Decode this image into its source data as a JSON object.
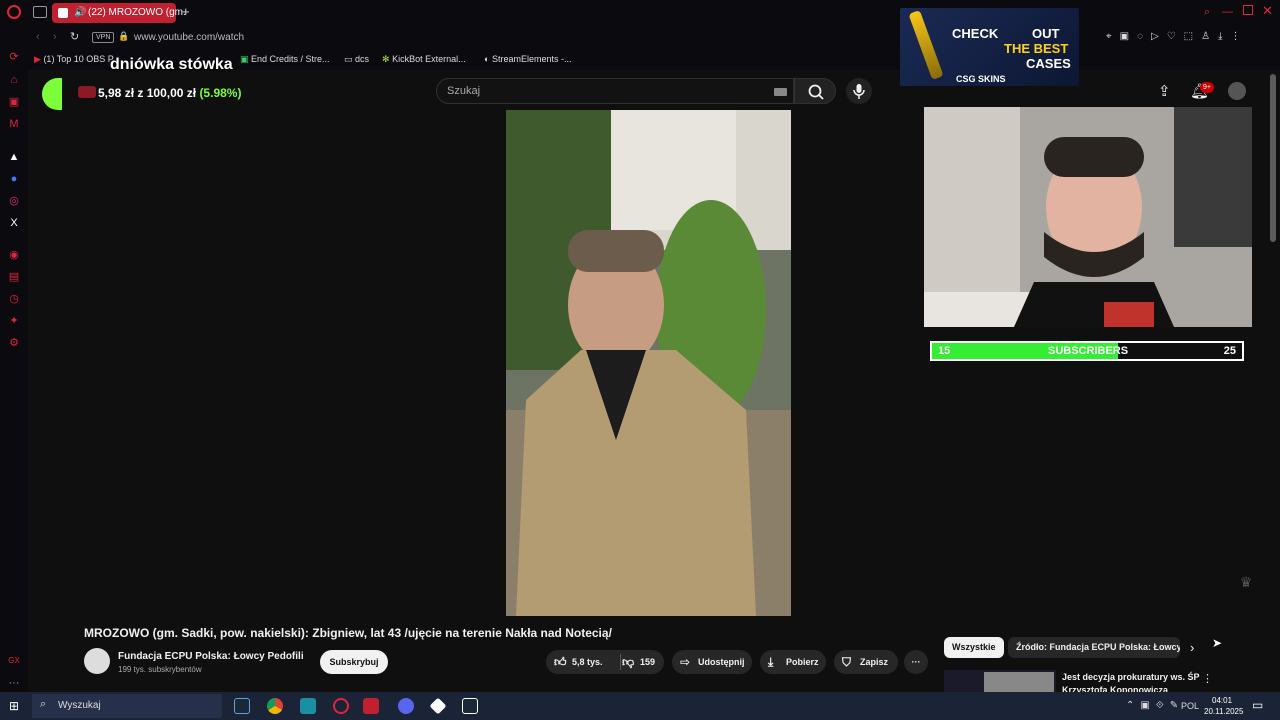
{
  "browser": {
    "tab_title": "(22) MROZOWO (gm.",
    "new_tab": "+",
    "vpn_badge": "VPN",
    "url": "www.youtube.com/watch",
    "bookmarks": [
      {
        "label": "(1) Top 10 OBS P"
      },
      {
        "label": "End Credits / Stre..."
      },
      {
        "label": "dcs"
      },
      {
        "label": "KickBot External..."
      },
      {
        "label": "StreamElements -..."
      }
    ]
  },
  "overlay": {
    "goal_title": "dniówka stówka",
    "goal_current": "5,98 zł",
    "goal_separator": "z",
    "goal_target": "100,00 zł",
    "goal_percent": "(5.98%)",
    "goal_progress": 0.0598,
    "subs_left": "15",
    "subs_label": "SUBSCRIBERS",
    "subs_right": "25",
    "subs_progress": 0.6,
    "banner_line1": "CHECK",
    "banner_line2": "OUT",
    "banner_line3": "THE BEST",
    "banner_line4": "CASES",
    "banner_brand": "CSG SKINS"
  },
  "youtube": {
    "search_placeholder": "Szukaj",
    "notif_count": "9+",
    "video_title": "MROZOWO (gm. Sadki, pow. nakielski): Zbigniew, lat 43 /ujęcie na terenie Nakła nad Notecią/",
    "channel_name": "Fundacja ECPU Polska: Łowcy Pedofili",
    "channel_subs": "199 tys. subskrybentów",
    "subscribe_label": "Subskrybuj",
    "likes": "5,8 tys.",
    "dislikes": "159",
    "share_label": "Udostępnij",
    "download_label": "Pobierz",
    "save_label": "Zapisz",
    "more_label": "···",
    "chips": [
      "Wszystkie",
      "Źródło: Fundacja ECPU Polska: Łowcy"
    ],
    "rec_title_1": "Jest decyzja prokuratury ws. ŚP",
    "rec_title_2": "Krzysztofa Koponowicza"
  },
  "taskbar": {
    "search_label": "Wyszukaj",
    "lang": "POL",
    "time": "04:01",
    "date": "20.11.2025"
  },
  "colors": {
    "accent": "#e1243a",
    "goal_green": "#7cff3a",
    "subs_green": "#33ee33"
  }
}
